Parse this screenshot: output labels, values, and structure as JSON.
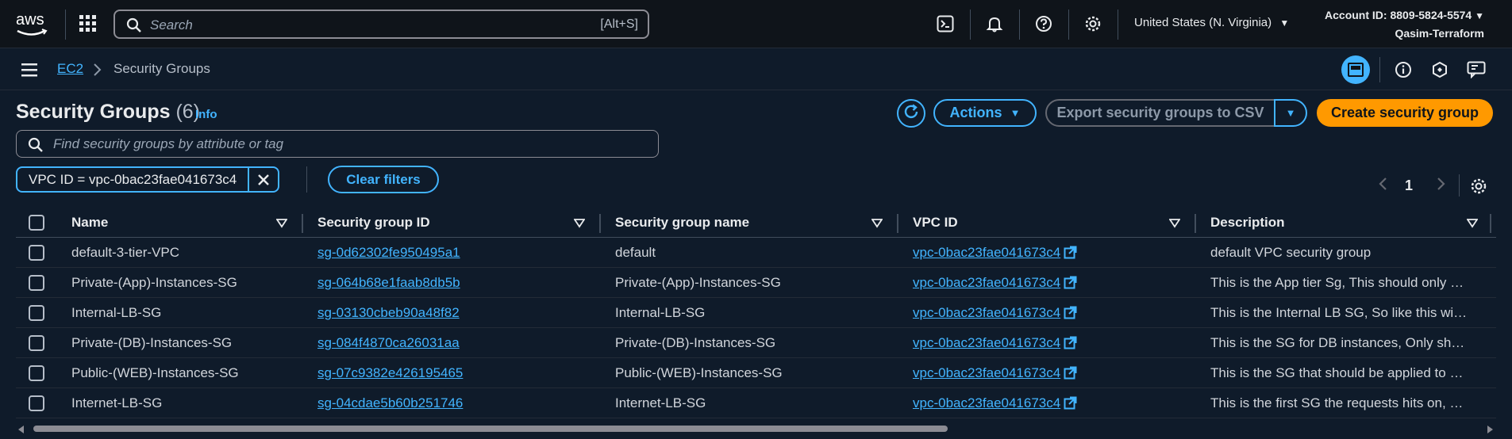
{
  "top_nav": {
    "logo_text": "aws",
    "search_placeholder": "Search",
    "search_shortcut": "[Alt+S]",
    "region": "United States (N. Virginia)",
    "account_id": "Account ID: 8809-5824-5574",
    "user": "Qasim-Terraform"
  },
  "breadcrumb": {
    "parent": "EC2",
    "current": "Security Groups"
  },
  "header": {
    "title": "Security Groups",
    "count": "(6)",
    "info": "Info",
    "actions_label": "Actions",
    "export_label": "Export security groups to CSV",
    "create_label": "Create security group"
  },
  "filter": {
    "placeholder": "Find security groups by attribute or tag",
    "token": "VPC ID = vpc-0bac23fae041673c4",
    "clear_label": "Clear filters"
  },
  "pagination": {
    "current_page": "1"
  },
  "table": {
    "columns": [
      "Name",
      "Security group ID",
      "Security group name",
      "VPC ID",
      "Description"
    ],
    "rows": [
      {
        "name": "default-3-tier-VPC",
        "sg_id": "sg-0d62302fe950495a1",
        "sg_name": "default",
        "vpc_id": "vpc-0bac23fae041673c4",
        "description": "default VPC security group"
      },
      {
        "name": "Private-(App)-Instances-SG",
        "sg_id": "sg-064b68e1faab8db5b",
        "sg_name": "Private-(App)-Instances-SG",
        "vpc_id": "vpc-0bac23fae041673c4",
        "description": "This is the App tier Sg, This should only …"
      },
      {
        "name": "Internal-LB-SG",
        "sg_id": "sg-03130cbeb90a48f82",
        "sg_name": "Internal-LB-SG",
        "vpc_id": "vpc-0bac23fae041673c4",
        "description": "This is the Internal LB SG, So like this wi…"
      },
      {
        "name": "Private-(DB)-Instances-SG",
        "sg_id": "sg-084f4870ca26031aa",
        "sg_name": "Private-(DB)-Instances-SG",
        "vpc_id": "vpc-0bac23fae041673c4",
        "description": "This is the SG for DB instances, Only sh…"
      },
      {
        "name": "Public-(WEB)-Instances-SG",
        "sg_id": "sg-07c9382e426195465",
        "sg_name": "Public-(WEB)-Instances-SG",
        "vpc_id": "vpc-0bac23fae041673c4",
        "description": "This is the SG that should be applied to …"
      },
      {
        "name": "Internet-LB-SG",
        "sg_id": "sg-04cdae5b60b251746",
        "sg_name": "Internet-LB-SG",
        "vpc_id": "vpc-0bac23fae041673c4",
        "description": "This is the first SG the requests hits on, …"
      }
    ]
  },
  "colors": {
    "accent": "#42b4ff",
    "primary_button": "#ff9900",
    "background": "#0f1b2a",
    "topbar": "#0f141a"
  },
  "icons": [
    "aws-logo",
    "apps-grid-icon",
    "search-icon",
    "cloudshell-icon",
    "bell-icon",
    "help-icon",
    "gear-icon",
    "menu-icon",
    "chevron-right-icon",
    "panel-icon",
    "info-icon",
    "hexagon-icon",
    "feedback-icon",
    "refresh-icon",
    "caret-down-icon",
    "close-icon",
    "external-link-icon"
  ]
}
